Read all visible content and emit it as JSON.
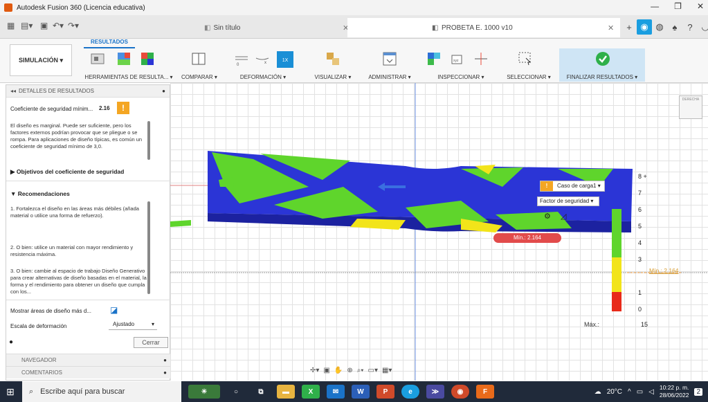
{
  "window": {
    "title": "Autodesk Fusion 360 (Licencia educativa)",
    "controls": [
      "—",
      "❐",
      "✕"
    ]
  },
  "tabs": {
    "inactive": "Sin título",
    "active": "PROBETA E. 1000 v10"
  },
  "ribbon": {
    "workspace": "SIMULACIÓN ▾",
    "results_tab": "RESULTADOS",
    "groups": [
      {
        "label": "HERRAMIENTAS DE RESULTA... ▾"
      },
      {
        "label": "COMPARAR ▾"
      },
      {
        "label": "DEFORMACIÓN ▾"
      },
      {
        "label": "VISUALIZAR ▾"
      },
      {
        "label": "ADMINISTRAR ▾"
      },
      {
        "label": "INSPECCIONAR ▾"
      },
      {
        "label": "SELECCIONAR ▾"
      },
      {
        "label": "FINALIZAR RESULTADOS ▾"
      }
    ],
    "deformation_badge": "1X"
  },
  "panel": {
    "header": "DETALLES DE RESULTADOS",
    "safety_label": "Coeficiente de seguridad mínim...",
    "safety_value": "2.16",
    "warning": "!",
    "description": "El diseño es marginal. Puede ser suficiente, pero los factores externos podrían provocar que se pliegue o se rompa. Para aplicaciones de diseño típicas, es común un coeficiente de seguridad mínimo de 3,0.",
    "objectives": "Objetivos del coeficiente de seguridad",
    "recommendations": "Recomendaciones",
    "rec1": "1. Fortalezca el diseño en las áreas más débiles (añada material o utilice una forma de refuerzo).",
    "rec2": "2. O bien: utilice un material con mayor rendimiento y resistencia máxima.",
    "rec3": "3. O bien: cambie al espacio de trabajo Diseño Generativo para crear alternativas de diseño basadas en el material, la forma y el rendimiento para obtener un diseño que cumpla con los...",
    "show_areas": "Mostrar áreas de diseño más d...",
    "deform_scale_label": "Escala de deformación",
    "deform_scale_value": "Ajustado",
    "close": "Cerrar",
    "browser": "NAVEGADOR",
    "comments": "COMENTARIOS"
  },
  "viewport": {
    "viewcube": "DERECHA",
    "load_case": "Caso de carga1 ▾",
    "result_type": "Factor de seguridad ▾",
    "min_badge": "Mín.: 2.164",
    "min_line_label": "Mín.: 2.164",
    "max_label": "Máx.:",
    "legend_ticks": [
      "8 +",
      "7",
      "6",
      "5",
      "4",
      "3",
      "1",
      "0"
    ],
    "legend_max": "15",
    "colors": {
      "blue": "#2b35d6",
      "green": "#5fd52c",
      "yellow": "#f2e41a",
      "red": "#e82a1a",
      "accent": "#1a73c8"
    }
  },
  "taskbar": {
    "search_placeholder": "Escribe aquí para buscar",
    "weather": "20°C",
    "time": "10:22 p. m.",
    "date": "28/06/2022",
    "notifications": "2"
  }
}
